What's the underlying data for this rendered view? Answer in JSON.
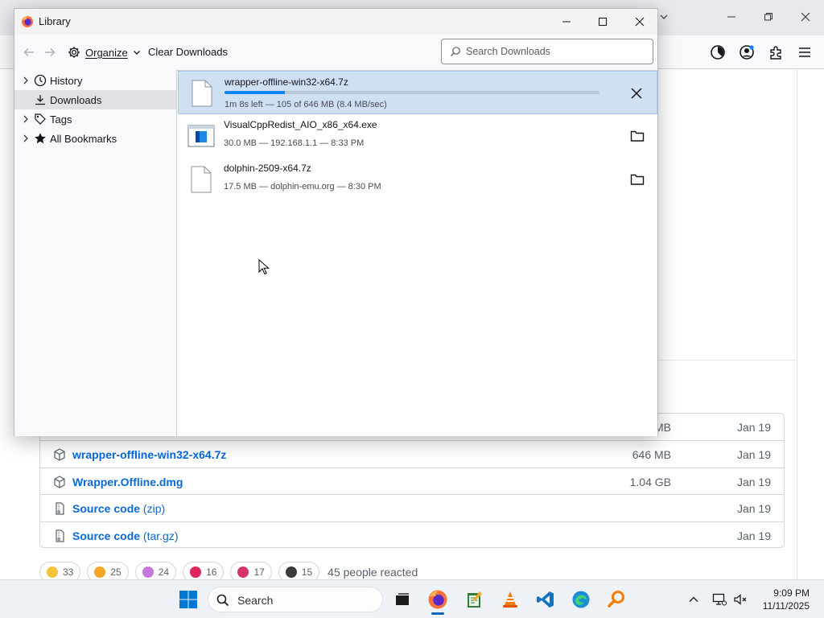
{
  "library": {
    "title": "Library",
    "toolbar": {
      "organize_label": "Organize",
      "clear_label": "Clear Downloads",
      "search_placeholder": "Search Downloads",
      "search_value": ""
    },
    "sidebar": [
      {
        "label": "History",
        "icon": "clock-icon",
        "expandable": true,
        "selected": false
      },
      {
        "label": "Downloads",
        "icon": "download-icon",
        "expandable": false,
        "selected": true
      },
      {
        "label": "Tags",
        "icon": "tag-icon",
        "expandable": true,
        "selected": false
      },
      {
        "label": "All Bookmarks",
        "icon": "star-icon",
        "expandable": true,
        "selected": false
      }
    ],
    "downloads": [
      {
        "name": "wrapper-offline-win32-x64.7z",
        "status": "1m 8s left — 105 of 646 MB (8.4 MB/sec)",
        "progress": 0.16,
        "icon": "file-icon",
        "action": "cancel-icon",
        "selected": true
      },
      {
        "name": "VisualCppRedist_AIO_x86_x64.exe",
        "status": "30.0 MB — 192.168.1.1 — 8:33 PM",
        "icon": "installer-icon",
        "action": "folder-icon",
        "selected": false
      },
      {
        "name": "dolphin-2509-x64.7z",
        "status": "17.5 MB — dolphin-emu.org — 8:30 PM",
        "icon": "file-icon",
        "action": "folder-icon",
        "selected": false
      }
    ]
  },
  "assets": {
    "rows": [
      {
        "name": "",
        "suffix": "",
        "size": "MB",
        "date": "Jan 19",
        "icon": "package-icon"
      },
      {
        "name": "wrapper-offline-win32-x64.7z",
        "suffix": "",
        "size": "646 MB",
        "date": "Jan 19",
        "icon": "package-icon"
      },
      {
        "name": "Wrapper.Offline.dmg",
        "suffix": "",
        "size": "1.04 GB",
        "date": "Jan 19",
        "icon": "package-icon"
      },
      {
        "name": "Source code",
        "suffix": " (zip)",
        "size": "",
        "date": "Jan 19",
        "icon": "file-zip-icon"
      },
      {
        "name": "Source code",
        "suffix": " (tar.gz)",
        "size": "",
        "date": "Jan 19",
        "icon": "file-zip-icon"
      }
    ]
  },
  "reactions": {
    "items": [
      {
        "emoji": "thumbs-up",
        "count": "33",
        "color": "#f5c33b"
      },
      {
        "emoji": "laugh",
        "count": "25",
        "color": "#f5a623"
      },
      {
        "emoji": "hooray",
        "count": "24",
        "color": "#c678dd"
      },
      {
        "emoji": "heart",
        "count": "16",
        "color": "#e0245e"
      },
      {
        "emoji": "rocket",
        "count": "17",
        "color": "#d6336c"
      },
      {
        "emoji": "eyes",
        "count": "15",
        "color": "#3b3b3b"
      }
    ],
    "summary": "45 people reacted"
  },
  "taskbar": {
    "search_label": "Search",
    "time": "9:09 PM",
    "date": "11/11/2025"
  },
  "colors": {
    "accent": "#0a84ff",
    "link": "#0969da",
    "selection": "#cfe0f5"
  }
}
